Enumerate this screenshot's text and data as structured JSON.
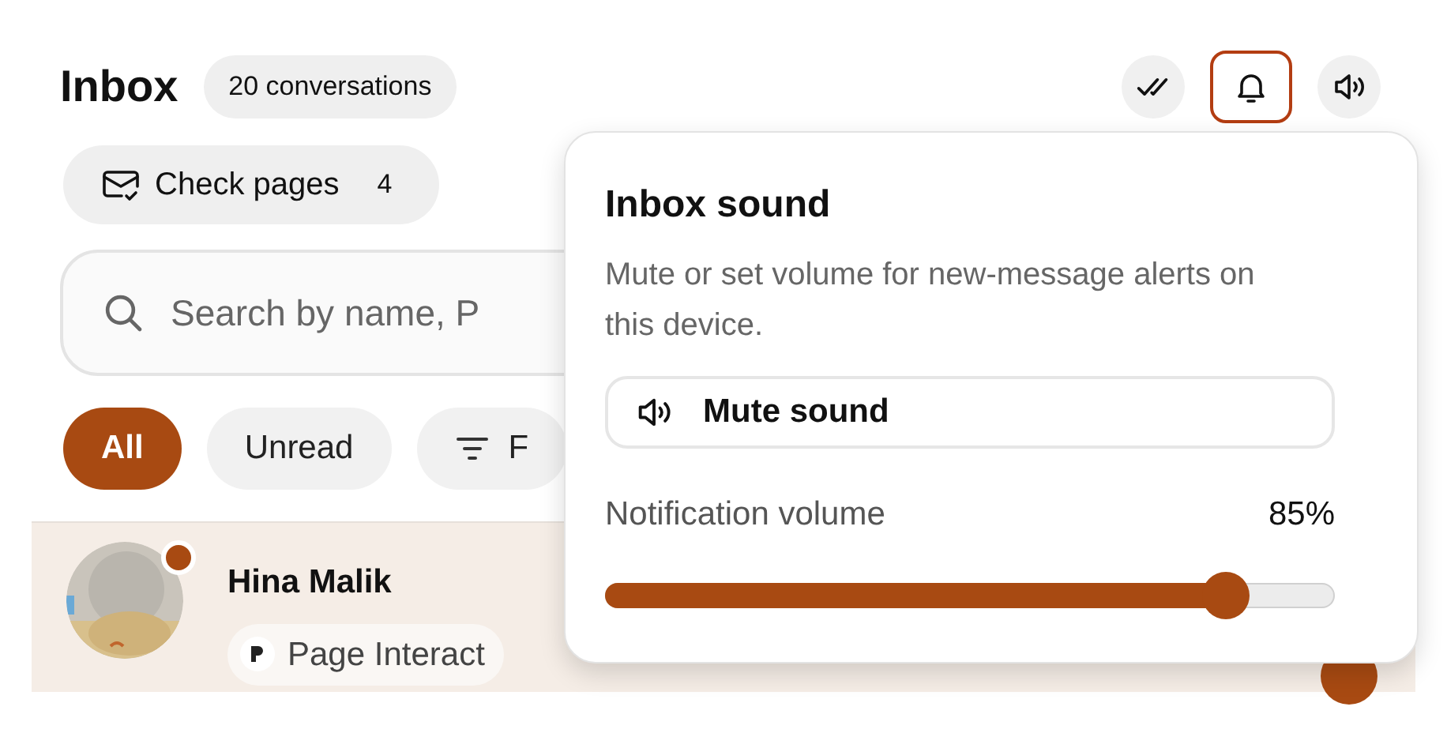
{
  "header": {
    "title": "Inbox",
    "count": "20 conversations"
  },
  "toolbar": [
    {
      "kind": "mark-read",
      "selected": false
    },
    {
      "kind": "bell",
      "selected": true
    },
    {
      "kind": "sound",
      "selected": false
    }
  ],
  "check_pages": {
    "label": "Check pages",
    "count": "4"
  },
  "search": {
    "placeholder": "Search by name, P"
  },
  "filters": [
    {
      "label": "All",
      "selected": true,
      "kind": "plain"
    },
    {
      "label": "Unread",
      "selected": false,
      "kind": "plain"
    },
    {
      "label": "F",
      "selected": false,
      "kind": "filter"
    }
  ],
  "conversations": [
    {
      "name": "Hina Malik",
      "unread": true,
      "source": "Page Interact"
    }
  ],
  "popover": {
    "title": "Inbox sound",
    "description": "Mute or set volume for new-message alerts on this device.",
    "mute_button": "Mute sound",
    "volume_label": "Notification volume",
    "volume_reading": "85%",
    "level": 0.85
  }
}
